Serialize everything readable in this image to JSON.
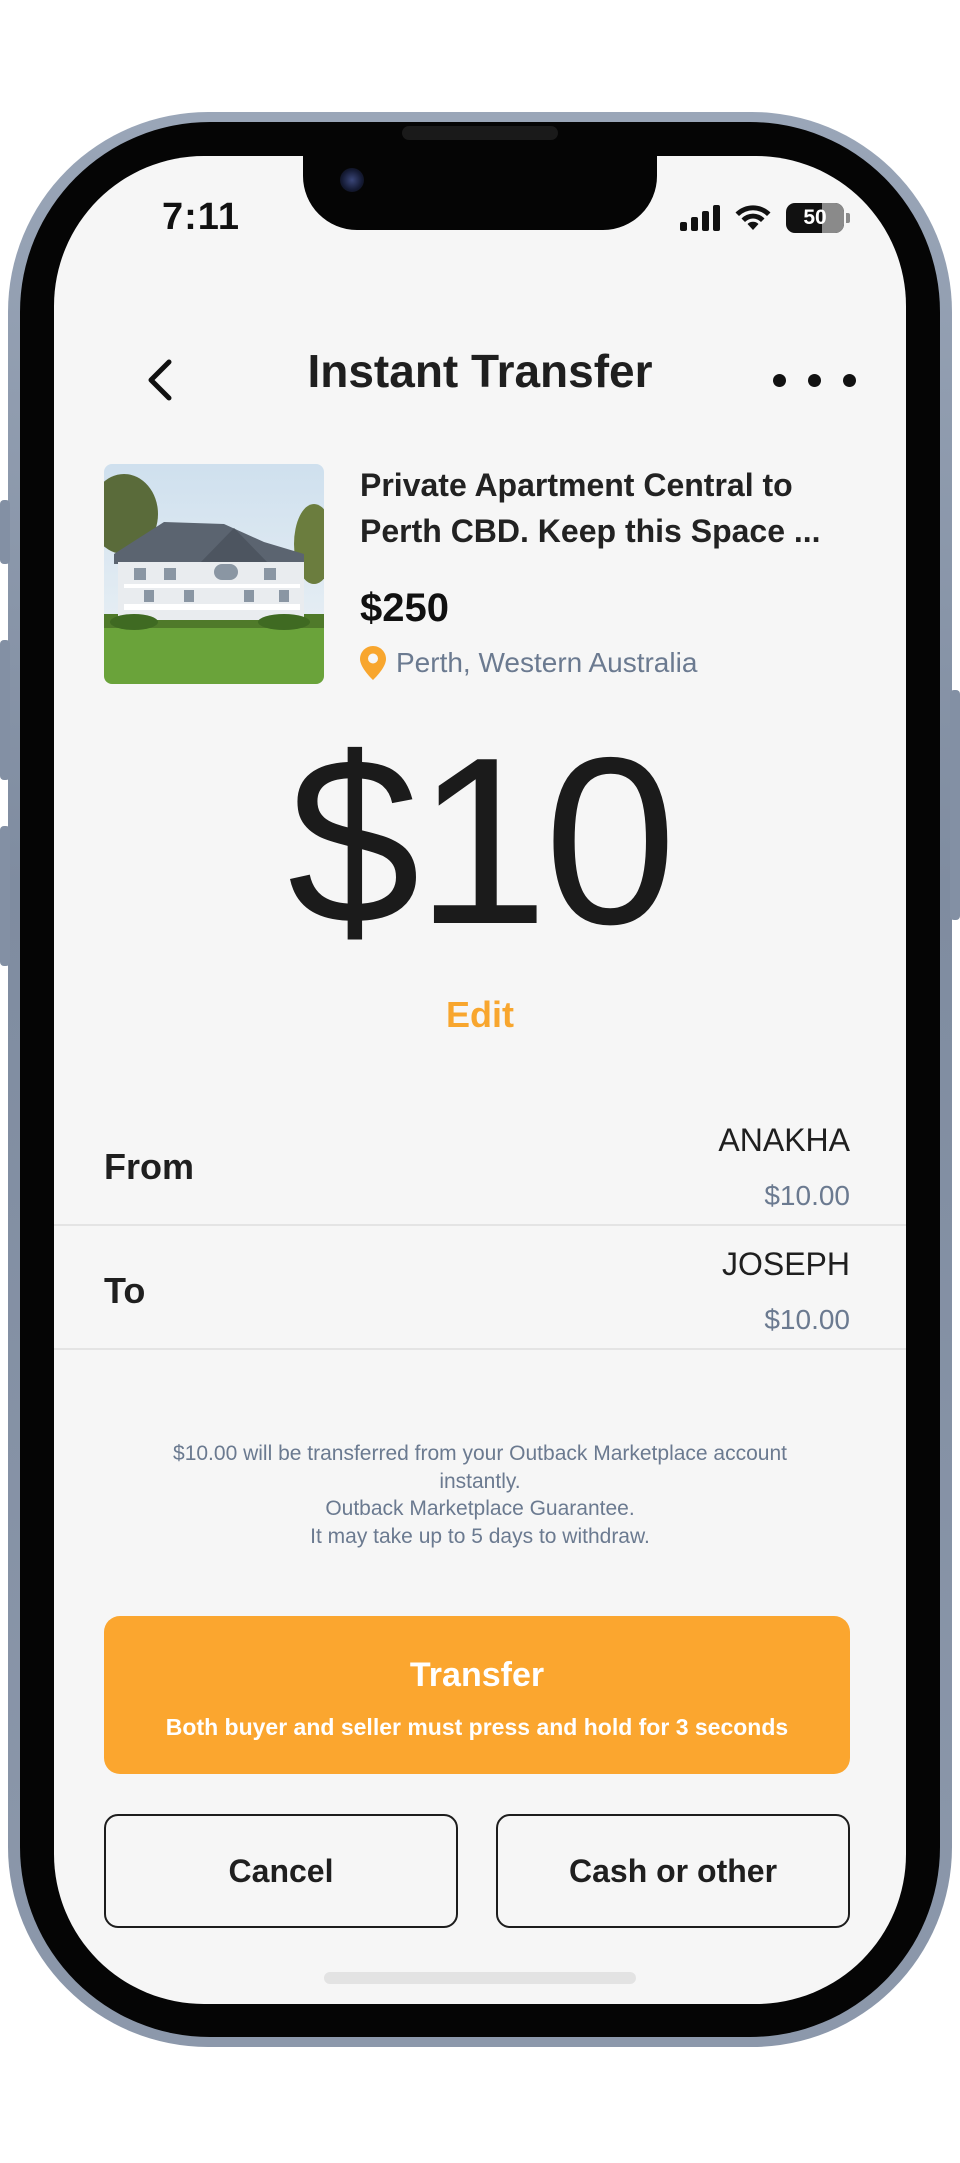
{
  "status_bar": {
    "time": "7:11",
    "battery": "50"
  },
  "nav": {
    "title": "Instant Transfer"
  },
  "listing": {
    "title": "Private Apartment Central to Perth CBD. Keep this Space ...",
    "price": "$250",
    "location": "Perth, Western Australia"
  },
  "transfer_amount": {
    "amount": "$10",
    "edit_label": "Edit"
  },
  "parties": {
    "from": {
      "label": "From",
      "name": "ANAKHA",
      "amount": "$10.00"
    },
    "to": {
      "label": "To",
      "name": "JOSEPH",
      "amount": "$10.00"
    }
  },
  "notes": [
    "$10.00 will be transferred from your Outback Marketplace account instantly.",
    "Outback Marketplace Guarantee.",
    "It may take up to 5 days to withdraw."
  ],
  "actions": {
    "transfer_label": "Transfer",
    "transfer_sub": "Both buyer and seller must press and hold  for 3 seconds",
    "cancel_label": "Cancel",
    "cash_label": "Cash or other"
  },
  "colors": {
    "accent": "#fba62f",
    "muted_text": "#6b7a90",
    "background": "#f6f6f6"
  },
  "icons": {
    "back": "chevron-left-icon",
    "more": "more-horizontal-icon",
    "location": "map-pin-icon",
    "signal": "cellular-signal-icon",
    "wifi": "wifi-icon",
    "battery": "battery-icon"
  }
}
